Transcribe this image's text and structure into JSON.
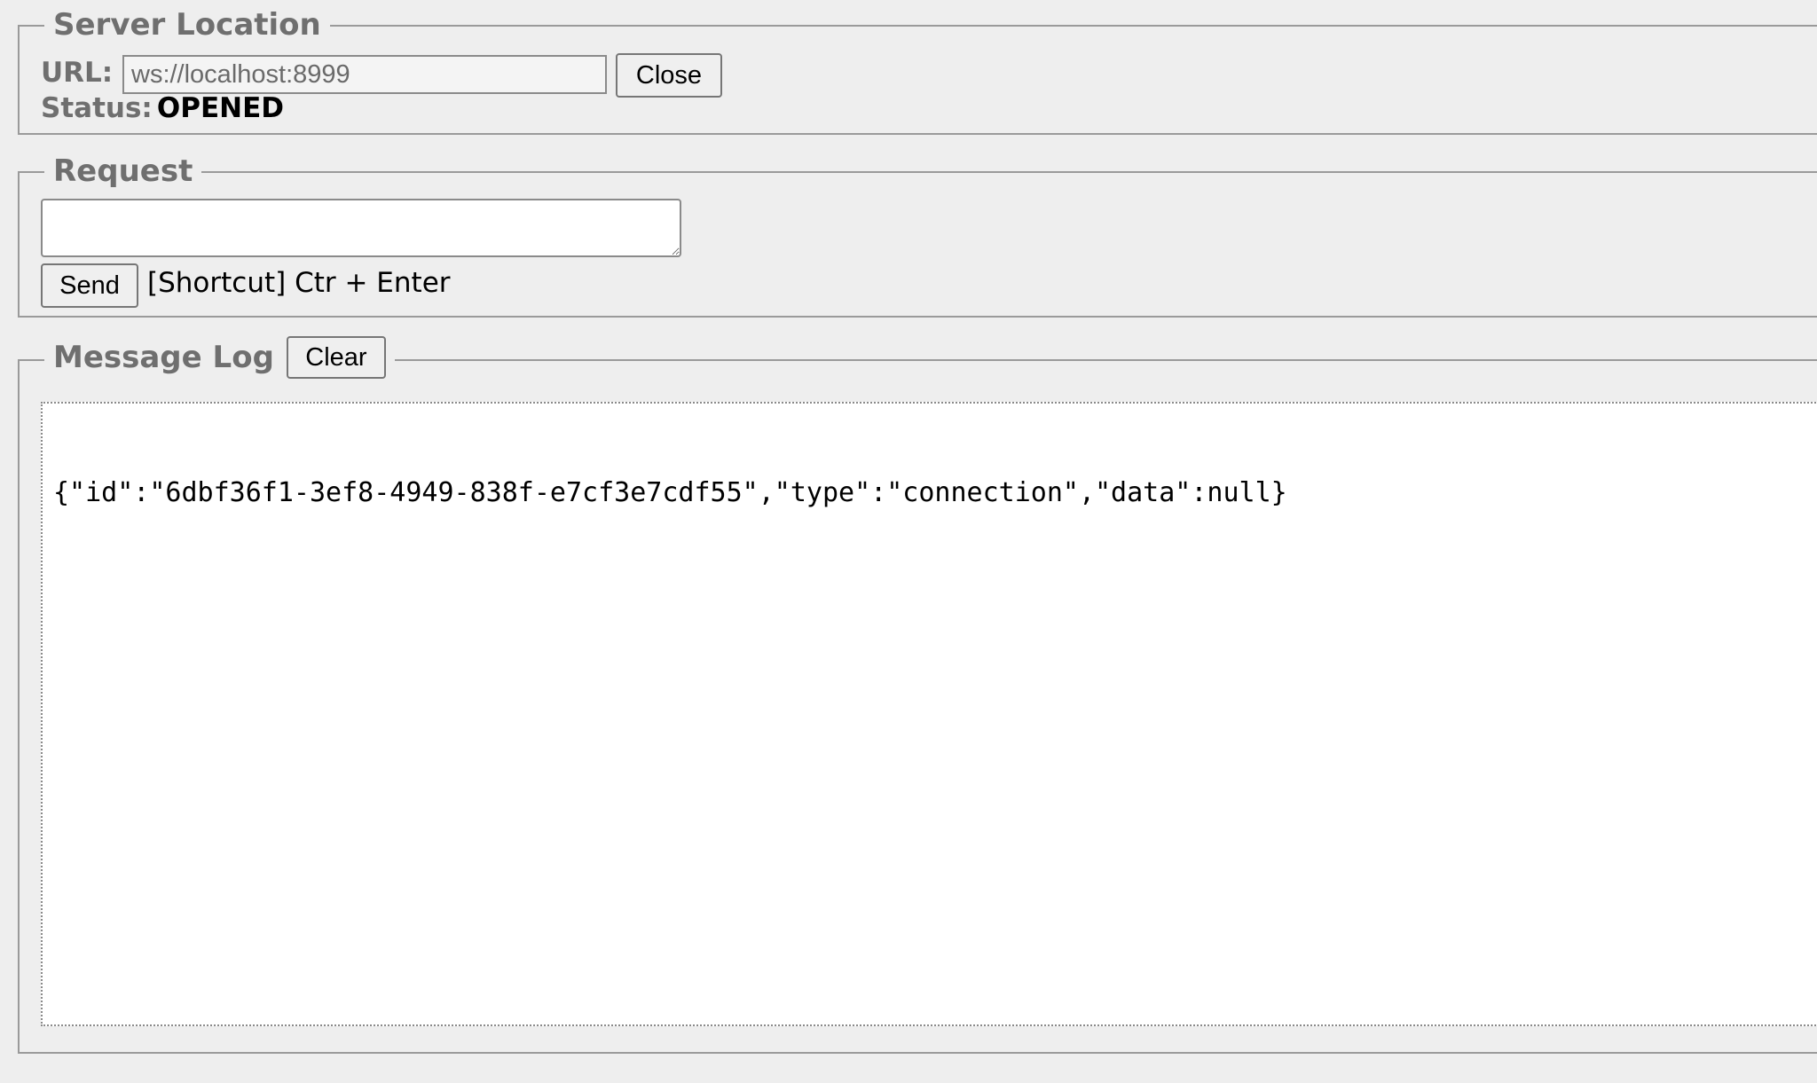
{
  "server": {
    "legend": "Server Location",
    "url_label": "URL:",
    "url_value": "ws://localhost:8999",
    "close_label": "Close",
    "status_label": "Status:",
    "status_value": "OPENED"
  },
  "request": {
    "legend": "Request",
    "textarea_value": "",
    "send_label": "Send",
    "shortcut_hint": "[Shortcut] Ctr + Enter"
  },
  "message_log": {
    "legend": "Message Log",
    "clear_label": "Clear",
    "entries": [
      "{\"id\":\"6dbf36f1-3ef8-4949-838f-e7cf3e7cdf55\",\"type\":\"connection\",\"data\":null}"
    ]
  }
}
